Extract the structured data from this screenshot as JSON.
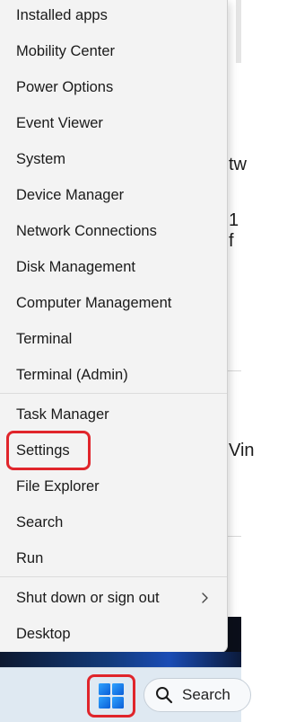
{
  "background": {
    "fragments": [
      "tw",
      "1 f",
      "Vin"
    ]
  },
  "menu": {
    "groups": [
      [
        "Installed apps",
        "Mobility Center",
        "Power Options",
        "Event Viewer",
        "System",
        "Device Manager",
        "Network Connections",
        "Disk Management",
        "Computer Management",
        "Terminal",
        "Terminal (Admin)"
      ],
      [
        "Task Manager",
        "Settings",
        "File Explorer",
        "Search",
        "Run"
      ],
      [
        "Shut down or sign out",
        "Desktop"
      ]
    ]
  },
  "taskbar": {
    "search_label": "Search",
    "start_icon": "windows-logo-icon",
    "search_icon": "search-icon"
  },
  "colors": {
    "highlight": "#e0252b",
    "menu_bg": "#f3f3f3",
    "taskbar_bg": "#dfe9f2",
    "windows_blue": "#1a73d9"
  }
}
